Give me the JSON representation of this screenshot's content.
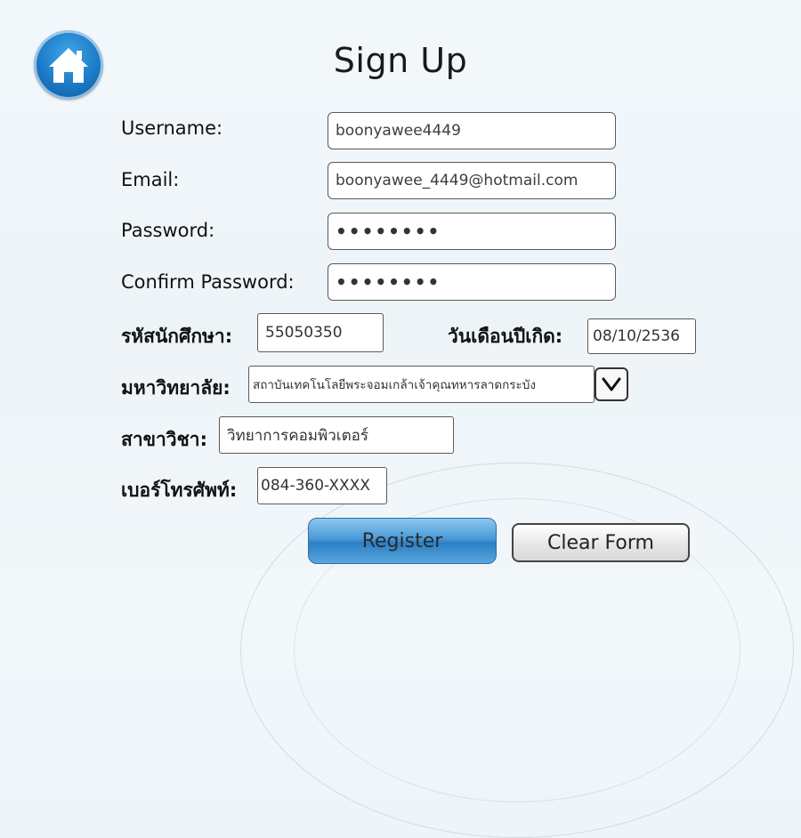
{
  "page": {
    "title": "Sign Up"
  },
  "home": {
    "icon": "home-icon",
    "color": "#1b79c5"
  },
  "form": {
    "username": {
      "label": "Username:",
      "value": "boonyawee4449"
    },
    "email": {
      "label": "Email:",
      "value": "boonyawee_4449@hotmail.com"
    },
    "password": {
      "label": "Password:",
      "value": "••••••••"
    },
    "confirm_password": {
      "label": "Confirm Password:",
      "value": "••••••••"
    },
    "student_id": {
      "label": "รหัสนักศึกษา:",
      "value": "55050350"
    },
    "birthdate": {
      "label": "วันเดือนปีเกิด:",
      "value": "08/10/2536"
    },
    "university": {
      "label": "มหาวิทยาลัย:",
      "value": "สถาบันเทคโนโลยีพระจอมเกล้าเจ้าคุณทหารลาดกระบัง",
      "dropdown_icon": "chevron-down-icon"
    },
    "major": {
      "label": "สาขาวิชา:",
      "value": "วิทยาการคอมพิวเตอร์"
    },
    "phone": {
      "label": "เบอร์โทรศัพท์:",
      "value": "084-360-XXXX"
    }
  },
  "buttons": {
    "register": "Register",
    "clear": "Clear Form",
    "register_color": "#4a9ad8"
  }
}
